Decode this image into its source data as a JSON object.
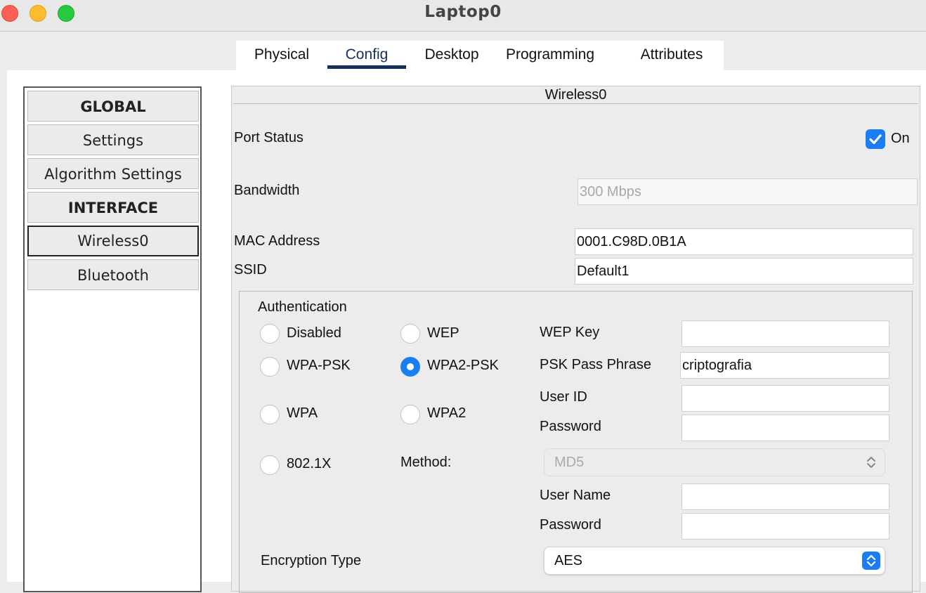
{
  "window": {
    "title": "Laptop0",
    "controls": [
      "close",
      "minimize",
      "zoom"
    ]
  },
  "tabs": [
    {
      "label": "Physical",
      "active": false
    },
    {
      "label": "Config",
      "active": true
    },
    {
      "label": "Desktop",
      "active": false
    },
    {
      "label": "Programming",
      "active": false
    },
    {
      "label": "Attributes",
      "active": false
    }
  ],
  "sidebar": {
    "items": [
      {
        "label": "GLOBAL",
        "type": "section"
      },
      {
        "label": "Settings",
        "type": "item"
      },
      {
        "label": "Algorithm Settings",
        "type": "item"
      },
      {
        "label": "INTERFACE",
        "type": "section"
      },
      {
        "label": "Wireless0",
        "type": "item",
        "selected": true
      },
      {
        "label": "Bluetooth",
        "type": "item"
      }
    ]
  },
  "panel": {
    "title": "Wireless0",
    "port_status": {
      "label": "Port Status",
      "checkbox_label": "On",
      "checked": true
    },
    "bandwidth": {
      "label": "Bandwidth",
      "value": "300 Mbps"
    },
    "mac_address": {
      "label": "MAC Address",
      "value": "0001.C98D.0B1A"
    },
    "ssid": {
      "label": "SSID",
      "value": "Default1"
    }
  },
  "authentication": {
    "title": "Authentication",
    "options": {
      "disabled": {
        "label": "Disabled",
        "checked": false
      },
      "wep": {
        "label": "WEP",
        "checked": false
      },
      "wpa_psk": {
        "label": "WPA-PSK",
        "checked": false
      },
      "wpa2_psk": {
        "label": "WPA2-PSK",
        "checked": true
      },
      "wpa": {
        "label": "WPA",
        "checked": false
      },
      "wpa2": {
        "label": "WPA2",
        "checked": false
      },
      "dot1x": {
        "label": "802.1X",
        "checked": false
      }
    },
    "wep_key": {
      "label": "WEP Key",
      "value": ""
    },
    "psk_pass_phrase": {
      "label": "PSK Pass Phrase",
      "value": "criptografia"
    },
    "user_id": {
      "label": "User ID",
      "value": ""
    },
    "password": {
      "label": "Password",
      "value": ""
    },
    "method": {
      "label": "Method:",
      "value": "MD5"
    },
    "user_name": {
      "label": "User Name",
      "value": ""
    },
    "password2": {
      "label": "Password",
      "value": ""
    }
  },
  "encryption": {
    "label": "Encryption Type",
    "value": "AES"
  },
  "colors": {
    "accent_blue": "#1a7ef2",
    "tab_underline": "#15305a",
    "close": "#fe5f57",
    "minimize": "#febc2e",
    "zoom": "#28c840"
  }
}
